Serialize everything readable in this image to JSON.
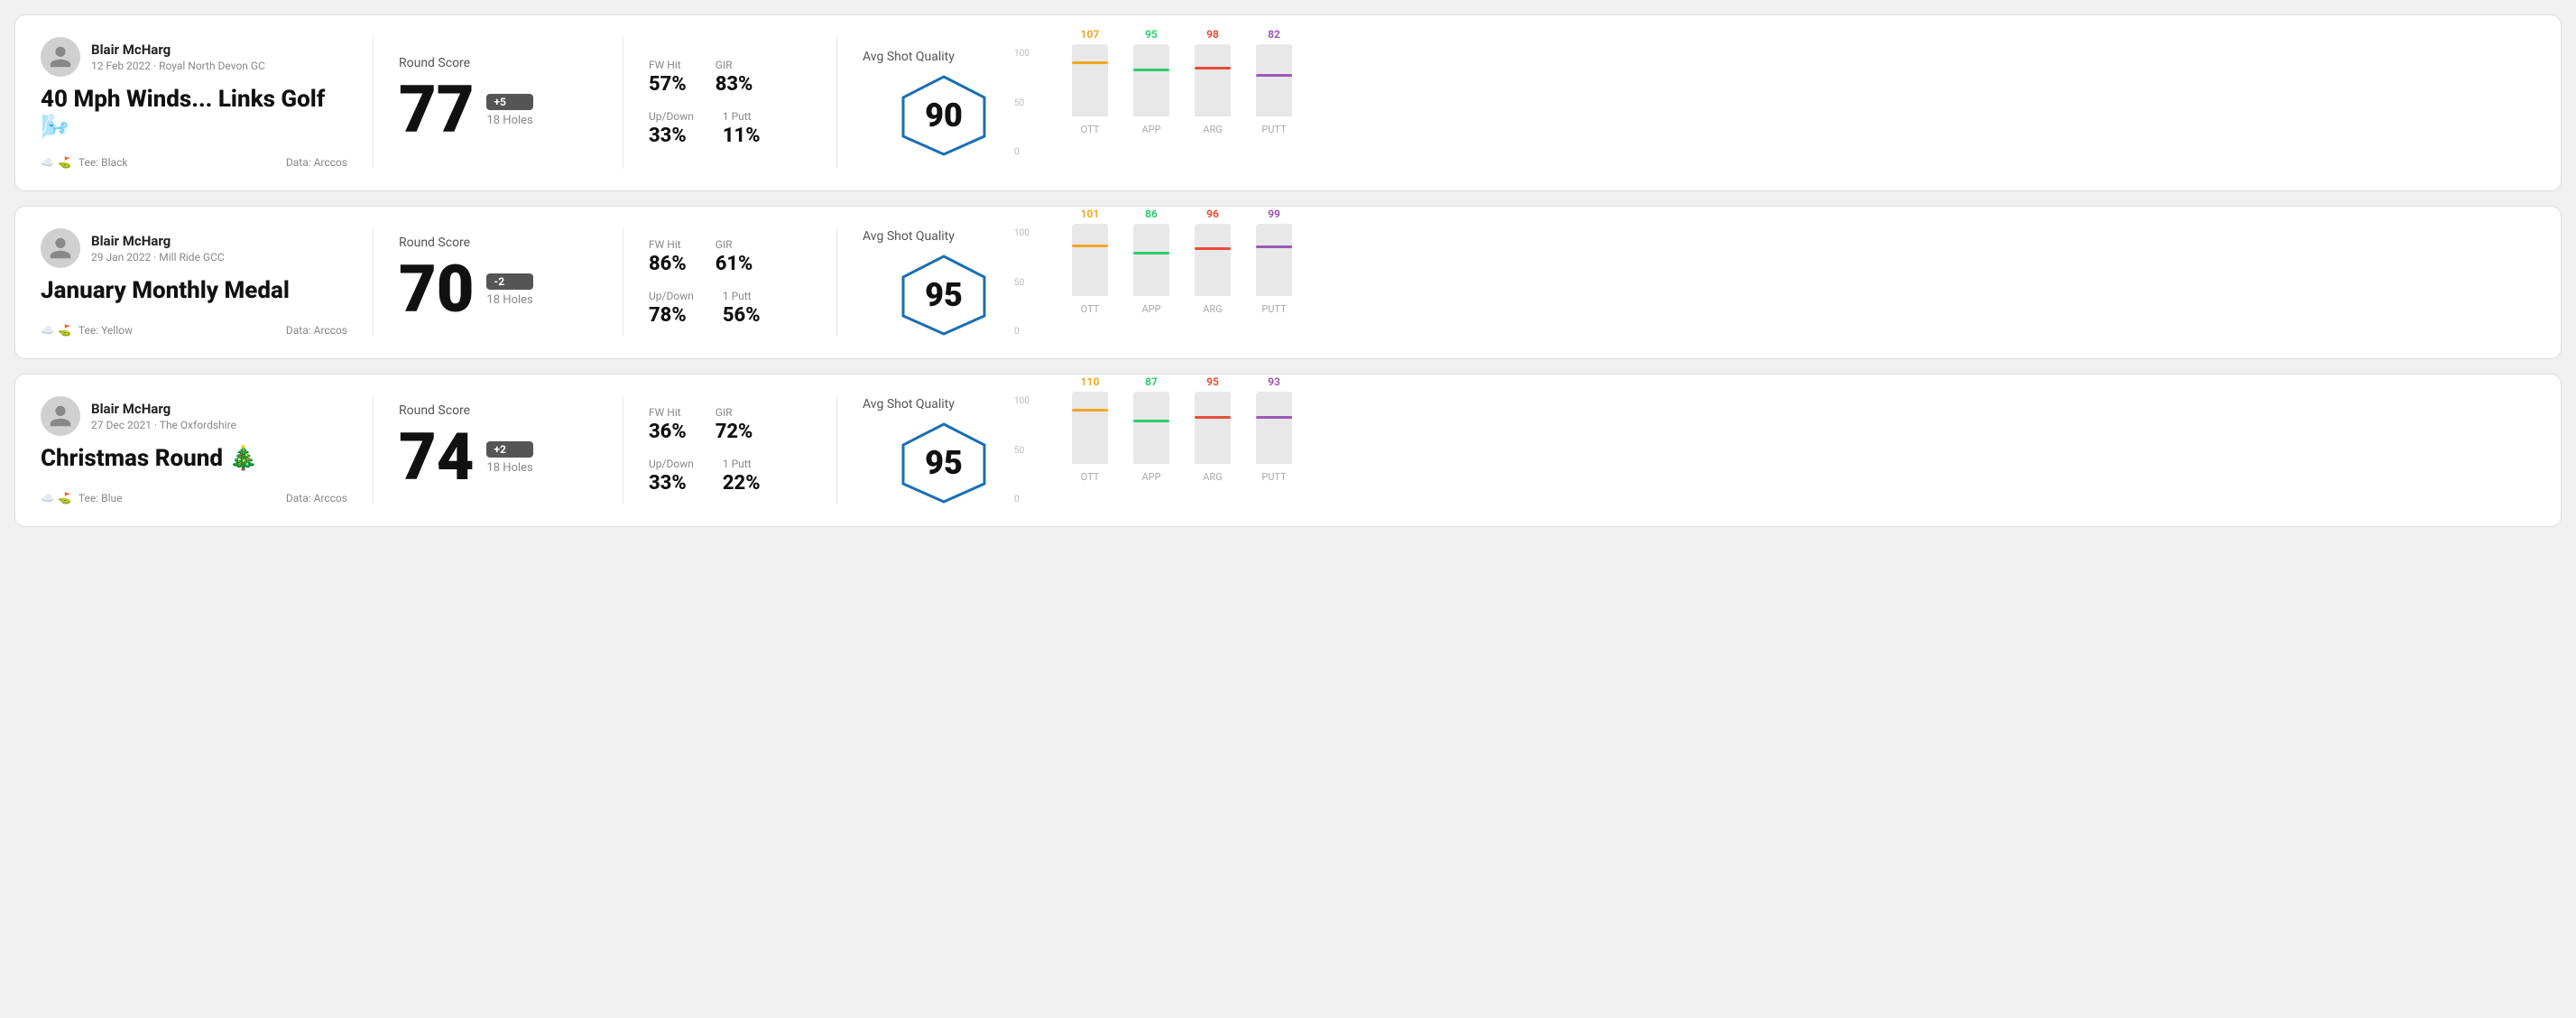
{
  "rounds": [
    {
      "id": "round-1",
      "user_name": "Blair McHarg",
      "user_date": "12 Feb 2022 · Royal North Devon GC",
      "round_title": "40 Mph Winds... Links Golf 🌬️",
      "tee": "Tee: Black",
      "data_source": "Data: Arccos",
      "round_score_label": "Round Score",
      "score": "77",
      "score_delta": "+5",
      "holes": "18 Holes",
      "fw_hit_label": "FW Hit",
      "fw_hit": "57%",
      "gir_label": "GIR",
      "gir": "83%",
      "updown_label": "Up/Down",
      "updown": "33%",
      "oneputt_label": "1 Putt",
      "oneputt": "11%",
      "quality_label": "Avg Shot Quality",
      "quality_score": "90",
      "chart": {
        "ott": {
          "label": "OTT",
          "value": 107,
          "color": "#f5a623",
          "bar_pct": 72
        },
        "app": {
          "label": "APP",
          "value": 95,
          "color": "#2ecc71",
          "bar_pct": 63
        },
        "arg": {
          "label": "ARG",
          "value": 98,
          "color": "#e74c3c",
          "bar_pct": 65
        },
        "putt": {
          "label": "PUTT",
          "value": 82,
          "color": "#9b59b6",
          "bar_pct": 55
        }
      }
    },
    {
      "id": "round-2",
      "user_name": "Blair McHarg",
      "user_date": "29 Jan 2022 · Mill Ride GCC",
      "round_title": "January Monthly Medal",
      "tee": "Tee: Yellow",
      "data_source": "Data: Arccos",
      "round_score_label": "Round Score",
      "score": "70",
      "score_delta": "-2",
      "holes": "18 Holes",
      "fw_hit_label": "FW Hit",
      "fw_hit": "86%",
      "gir_label": "GIR",
      "gir": "61%",
      "updown_label": "Up/Down",
      "updown": "78%",
      "oneputt_label": "1 Putt",
      "oneputt": "56%",
      "quality_label": "Avg Shot Quality",
      "quality_score": "95",
      "chart": {
        "ott": {
          "label": "OTT",
          "value": 101,
          "color": "#f5a623",
          "bar_pct": 68
        },
        "app": {
          "label": "APP",
          "value": 86,
          "color": "#2ecc71",
          "bar_pct": 57
        },
        "arg": {
          "label": "ARG",
          "value": 96,
          "color": "#e74c3c",
          "bar_pct": 64
        },
        "putt": {
          "label": "PUTT",
          "value": 99,
          "color": "#9b59b6",
          "bar_pct": 66
        }
      }
    },
    {
      "id": "round-3",
      "user_name": "Blair McHarg",
      "user_date": "27 Dec 2021 · The Oxfordshire",
      "round_title": "Christmas Round 🎄",
      "tee": "Tee: Blue",
      "data_source": "Data: Arccos",
      "round_score_label": "Round Score",
      "score": "74",
      "score_delta": "+2",
      "holes": "18 Holes",
      "fw_hit_label": "FW Hit",
      "fw_hit": "36%",
      "gir_label": "GIR",
      "gir": "72%",
      "updown_label": "Up/Down",
      "updown": "33%",
      "oneputt_label": "1 Putt",
      "oneputt": "22%",
      "quality_label": "Avg Shot Quality",
      "quality_score": "95",
      "chart": {
        "ott": {
          "label": "OTT",
          "value": 110,
          "color": "#f5a623",
          "bar_pct": 73
        },
        "app": {
          "label": "APP",
          "value": 87,
          "color": "#2ecc71",
          "bar_pct": 58
        },
        "arg": {
          "label": "ARG",
          "value": 95,
          "color": "#e74c3c",
          "bar_pct": 63
        },
        "putt": {
          "label": "PUTT",
          "value": 93,
          "color": "#9b59b6",
          "bar_pct": 62
        }
      }
    }
  ],
  "chart_y_labels": [
    "100",
    "50",
    "0"
  ]
}
